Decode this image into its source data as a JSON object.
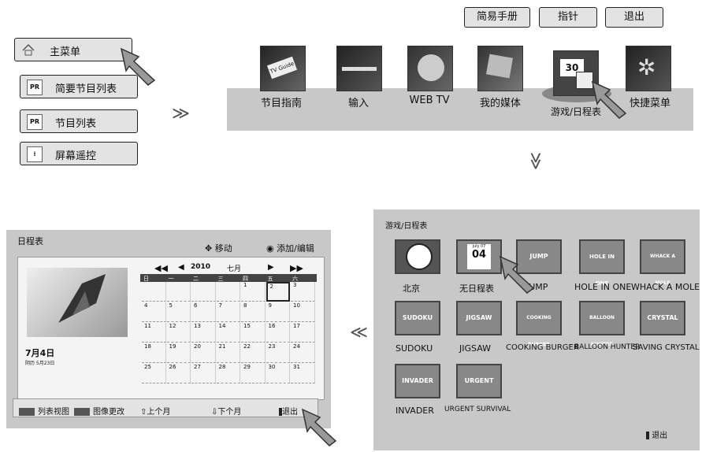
{
  "top_buttons": {
    "guide": "简易手册",
    "pointer": "指针",
    "exit": "退出"
  },
  "sidebar": {
    "items": [
      {
        "label": "主菜单",
        "icon": "home-icon"
      },
      {
        "label": "简要节目列表",
        "icon": "pr-list-icon"
      },
      {
        "label": "节目列表",
        "icon": "pr-grid-icon"
      },
      {
        "label": "屏幕遥控",
        "icon": "remote-icon"
      }
    ]
  },
  "main_menu": {
    "items": [
      {
        "label": "节目指南",
        "icon": "tv-guide-icon"
      },
      {
        "label": "输入",
        "icon": "input-cable-icon"
      },
      {
        "label": "WEB TV",
        "icon": "globe-icon"
      },
      {
        "label": "我的媒体",
        "icon": "media-icon"
      },
      {
        "label": "游戏/日程表",
        "icon": "calendar-dice-icon"
      },
      {
        "label": "快捷菜单",
        "icon": "gear-icon"
      }
    ]
  },
  "arrows": {
    "right": "≫",
    "down": "≫",
    "left": "≪"
  },
  "games_panel": {
    "title": "游戏/日程表",
    "exit_label": "退出",
    "items": [
      {
        "label": "北京",
        "tile": "clock"
      },
      {
        "label": "无日程表",
        "tile": "04"
      },
      {
        "label": "JUMP",
        "tile": "JUMP"
      },
      {
        "label": "HOLE IN ONE",
        "tile": "HOLE IN ONE"
      },
      {
        "label": "WHACK A MOLE",
        "tile": "WHACK A MOLE"
      },
      {
        "label": "SUDOKU",
        "tile": "SUDOKU"
      },
      {
        "label": "JIGSAW",
        "tile": "JIGSAW"
      },
      {
        "label": "COOKING BURGER",
        "tile": "COOKING BURGER"
      },
      {
        "label": "BALLOON HUNTER",
        "tile": "BALLOON HUNTER"
      },
      {
        "label": "SAVING CRYSTAL",
        "tile": "CRYSTAL"
      },
      {
        "label": "INVADER",
        "tile": "INVADER"
      },
      {
        "label": "URGENT SURVIVAL",
        "tile": "URGENT"
      }
    ],
    "calendar_tile": {
      "month": "july 07",
      "day": "04"
    }
  },
  "schedule_panel": {
    "title": "日程表",
    "move_label": "移动",
    "add_edit_label": "添加/编辑",
    "year": "2010",
    "month": "七月",
    "weekdays": [
      "日",
      "一",
      "二",
      "三",
      "四",
      "五",
      "六"
    ],
    "days": [
      [
        "",
        "",
        "",
        "",
        "1",
        "2",
        "3"
      ],
      [
        "4",
        "5",
        "6",
        "7",
        "8",
        "9",
        "10"
      ],
      [
        "11",
        "12",
        "13",
        "14",
        "15",
        "16",
        "17"
      ],
      [
        "18",
        "19",
        "20",
        "21",
        "22",
        "23",
        "24"
      ],
      [
        "25",
        "26",
        "27",
        "28",
        "29",
        "30",
        "31"
      ]
    ],
    "date_label": "7月4日",
    "lunar_label": "阴历 5月23日",
    "footer": {
      "list_view": "列表视图",
      "change_image": "图像更改",
      "prev_month": "上个月",
      "next_month": "下个月",
      "exit": "退出"
    }
  },
  "colors": {
    "panel_gray": "#c8c8c8",
    "button_gray": "#e3e3e3",
    "dark_bar": "#444444"
  }
}
